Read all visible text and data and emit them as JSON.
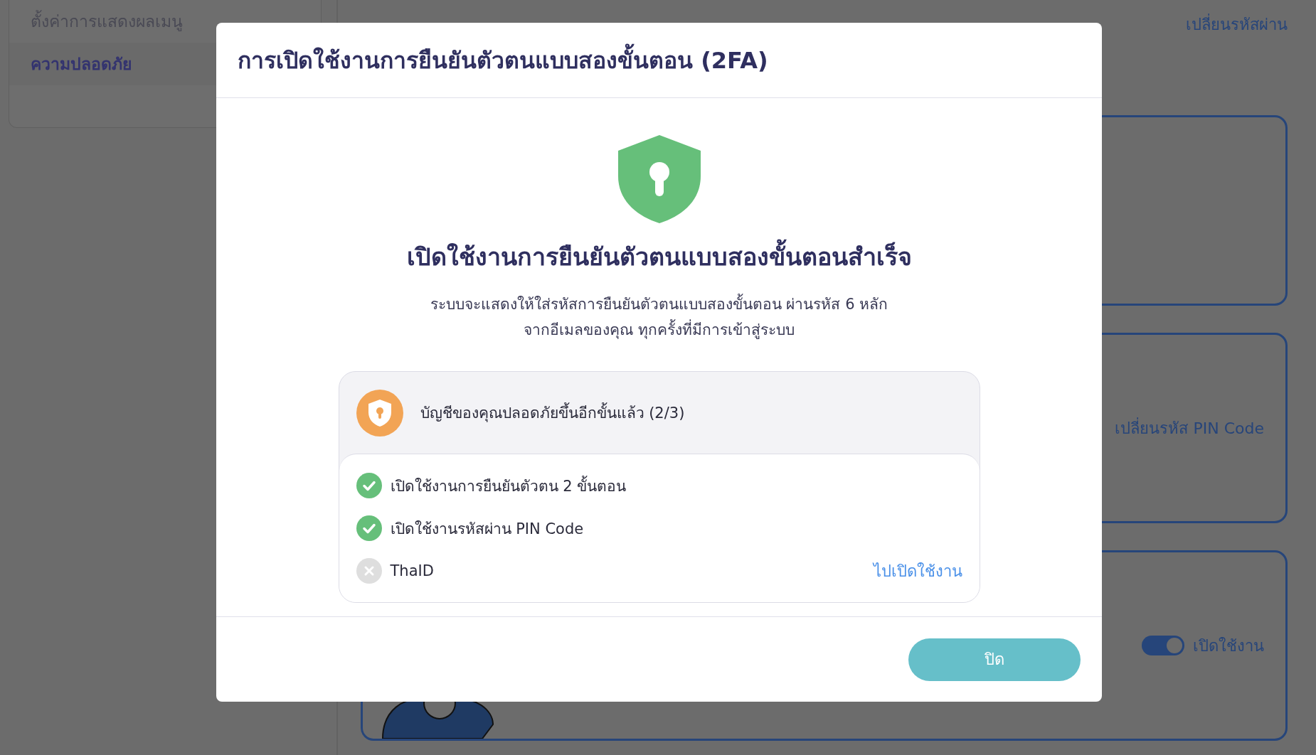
{
  "sidebar": {
    "items": [
      {
        "label": "ตั้งค่าการแสดงผลเมนู",
        "selected": false
      },
      {
        "label": "ความปลอดภัย",
        "selected": true
      }
    ]
  },
  "main": {
    "header_link": "เปลี่ยนรหัสผ่าน",
    "cards": [
      {
        "kind": "blank"
      },
      {
        "kind": "link",
        "link": "เปลี่ยนรหัส PIN Code"
      },
      {
        "kind": "toggle",
        "on": true,
        "label": "เปิดใช้งาน"
      }
    ]
  },
  "modal": {
    "title": "การเปิดใช้งานการยืนยันตัวตนแบบสองขั้นตอน (2FA)",
    "heading": "เปิดใช้งานการยืนยันตัวตนแบบสองขั้นตอนสำเร็จ",
    "description": [
      "ระบบจะแสดงให้ใส่รหัสการยืนยันตัวตนแบบสองขั้นตอน ผ่านรหัส 6 หลัก",
      "จากอีเมลของคุณ ทุกครั้งที่มีการเข้าสู่ระบบ"
    ],
    "summary": "บัญชีของคุณปลอดภัยขึ้นอีกขั้นแล้ว (2/3)",
    "items": [
      {
        "label": "เปิดใช้งานการยืนยันตัวตน 2 ขั้นตอน",
        "done": true
      },
      {
        "label": "เปิดใช้งานรหัสผ่าน PIN Code",
        "done": true
      },
      {
        "label": "ThaID",
        "done": false,
        "action": "ไปเปิดใช้งาน"
      }
    ],
    "close_button": "ปิด"
  }
}
